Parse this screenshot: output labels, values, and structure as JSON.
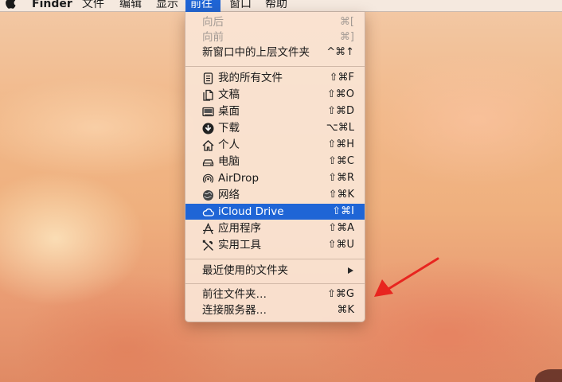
{
  "menubar": {
    "app_name": "Finder",
    "items": [
      {
        "label": "文件"
      },
      {
        "label": "编辑"
      },
      {
        "label": "显示"
      },
      {
        "label": "前往"
      },
      {
        "label": "窗口"
      },
      {
        "label": "帮助"
      }
    ],
    "active_menu": "前往"
  },
  "go_menu": {
    "nav": [
      {
        "label": "向后",
        "shortcut": "⌘[",
        "enabled": false
      },
      {
        "label": "向前",
        "shortcut": "⌘]",
        "enabled": false
      },
      {
        "label": "新窗口中的上层文件夹",
        "shortcut": "^⌘↑",
        "enabled": true
      }
    ],
    "places": [
      {
        "label": "我的所有文件",
        "shortcut": "⇧⌘F",
        "icon": "all-files-icon"
      },
      {
        "label": "文稿",
        "shortcut": "⇧⌘O",
        "icon": "documents-icon"
      },
      {
        "label": "桌面",
        "shortcut": "⇧⌘D",
        "icon": "desktop-icon"
      },
      {
        "label": "下载",
        "shortcut": "⌥⌘L",
        "icon": "download-icon"
      },
      {
        "label": "个人",
        "shortcut": "⇧⌘H",
        "icon": "home-icon"
      },
      {
        "label": "电脑",
        "shortcut": "⇧⌘C",
        "icon": "computer-icon"
      },
      {
        "label": "AirDrop",
        "shortcut": "⇧⌘R",
        "icon": "airdrop-icon"
      },
      {
        "label": "网络",
        "shortcut": "⇧⌘K",
        "icon": "network-icon"
      },
      {
        "label": "iCloud Drive",
        "shortcut": "⇧⌘I",
        "icon": "icloud-icon",
        "selected": true
      },
      {
        "label": "应用程序",
        "shortcut": "⇧⌘A",
        "icon": "applications-icon"
      },
      {
        "label": "实用工具",
        "shortcut": "⇧⌘U",
        "icon": "utilities-icon"
      }
    ],
    "recent": {
      "label": "最近使用的文件夹",
      "has_submenu": true
    },
    "goto_folder": {
      "label": "前往文件夹…",
      "shortcut": "⇧⌘G"
    },
    "connect_server": {
      "label": "连接服务器…",
      "shortcut": "⌘K"
    }
  },
  "colors": {
    "selection": "#1f65d6",
    "annotation_arrow": "#e8251f",
    "disabled_text": "#a39a94"
  }
}
